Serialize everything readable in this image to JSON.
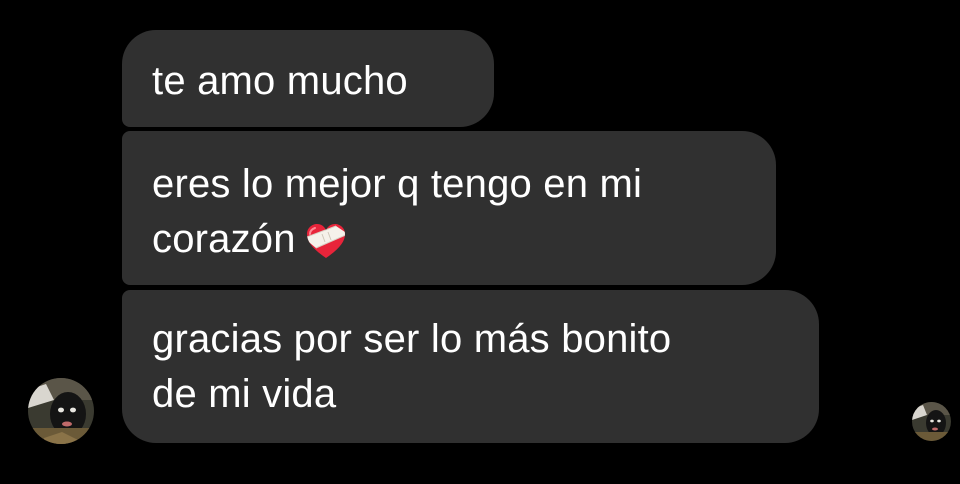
{
  "conversation": {
    "messages": [
      {
        "lines": [
          "te amo mucho"
        ]
      },
      {
        "lines": [
          "eres lo mejor q tengo en mi",
          "corazón"
        ],
        "emoji": "mending-heart-icon"
      },
      {
        "lines": [
          "gracias por ser lo más bonito",
          "de mi vida"
        ]
      }
    ]
  },
  "colors": {
    "background": "#000000",
    "bubble": "#303030",
    "text": "#ffffff",
    "heart_red": "#e8243a"
  },
  "icons": {
    "sender_avatar": "profile-photo-icon",
    "read_receipt_avatar": "seen-avatar-icon"
  }
}
